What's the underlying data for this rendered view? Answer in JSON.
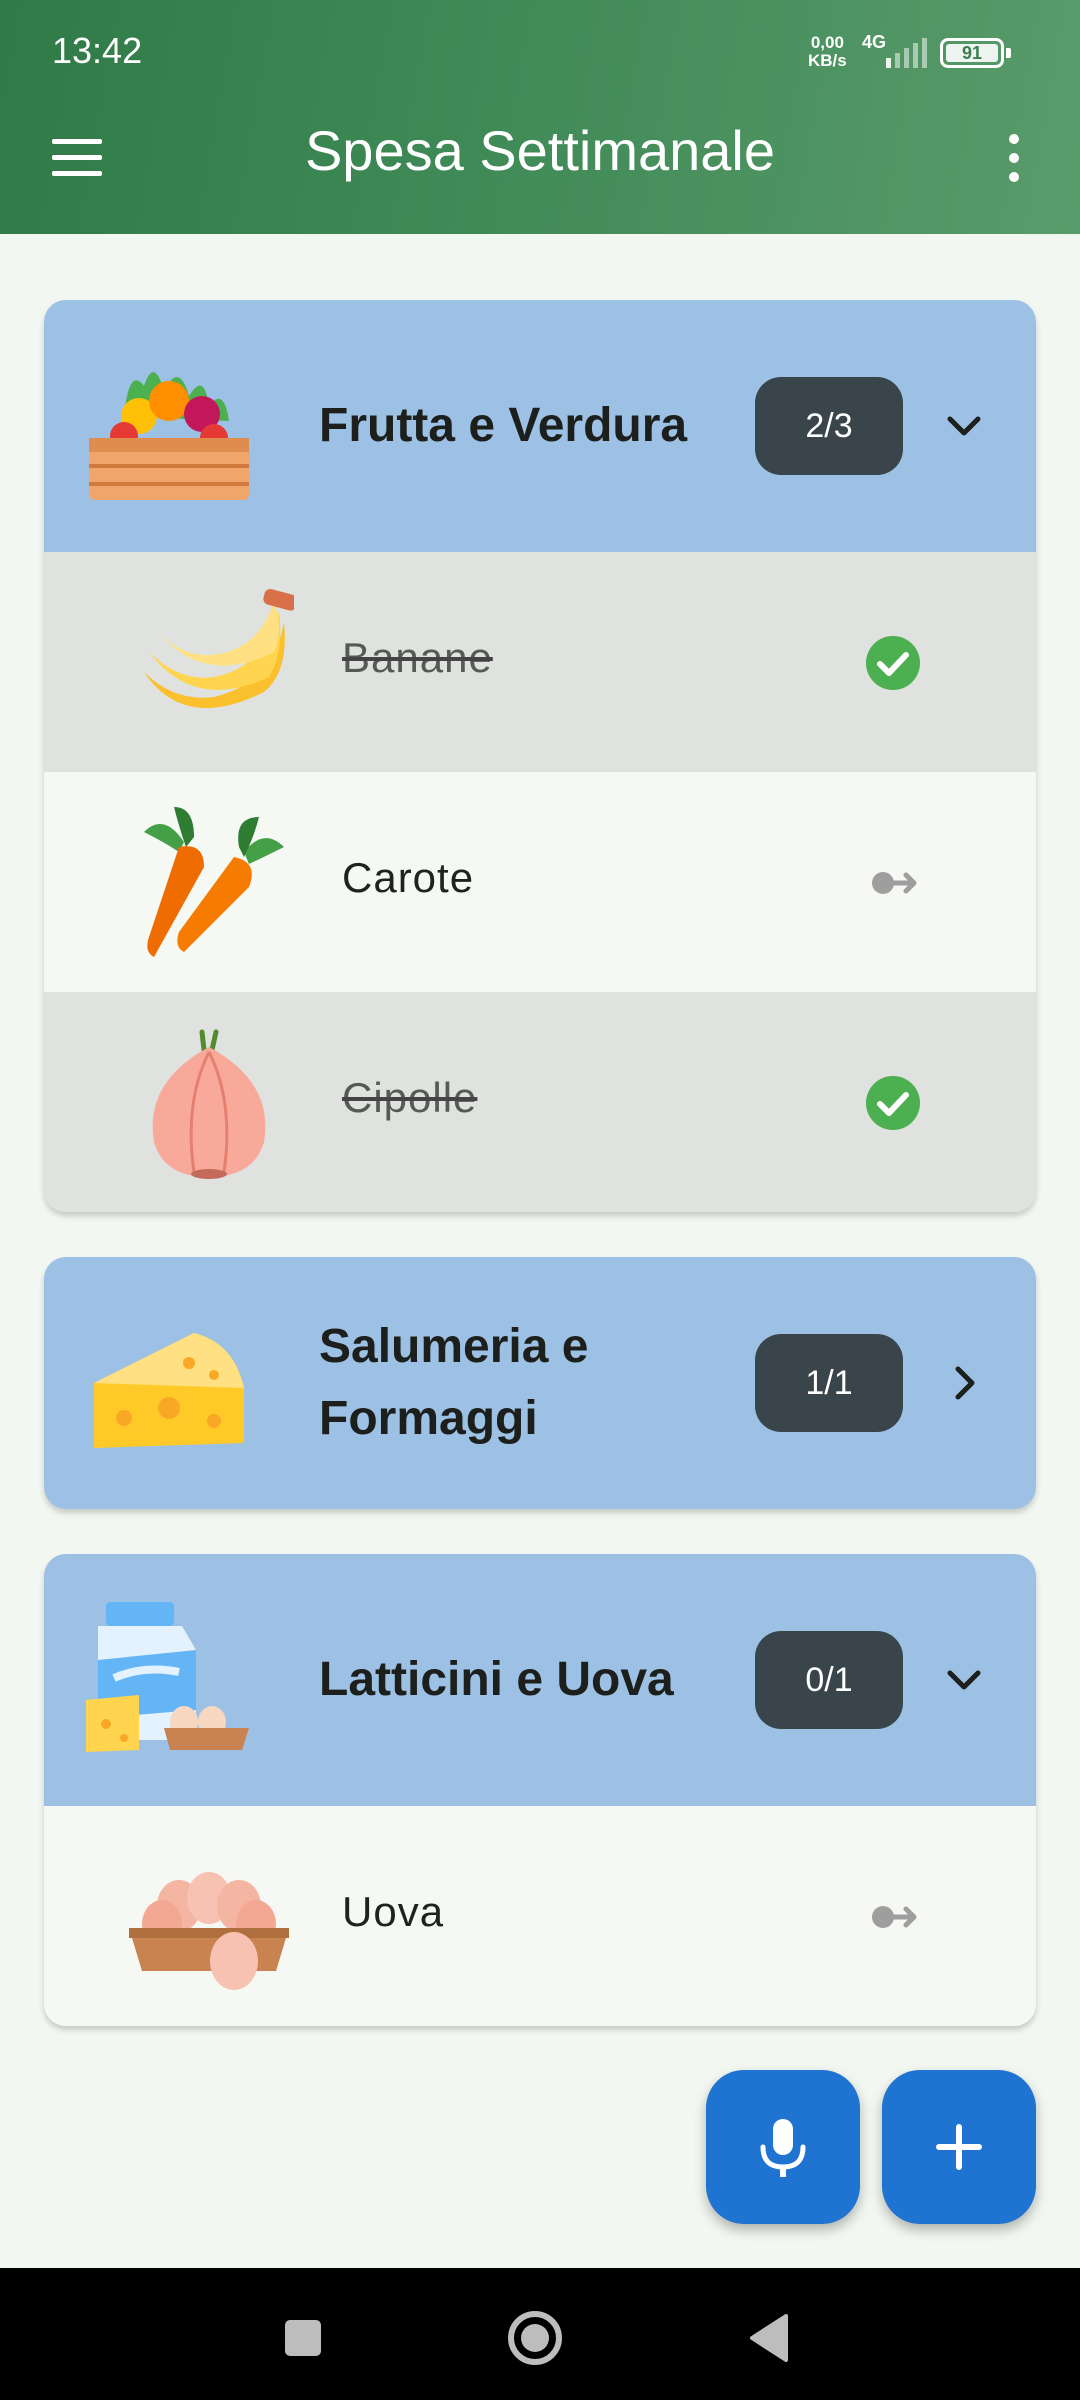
{
  "status_bar": {
    "time": "13:42",
    "net_speed_value": "0,00",
    "net_speed_unit": "KB/s",
    "network_type": "4G",
    "battery": "91"
  },
  "app_bar": {
    "title": "Spesa Settimanale",
    "menu_icon": "hamburger-menu-icon",
    "more_icon": "more-vert-icon"
  },
  "categories": [
    {
      "name": "Frutta e Verdura",
      "count": "2/3",
      "expanded": true,
      "icon": "vegetable-crate-icon",
      "items": [
        {
          "name": "Banane",
          "checked": true,
          "icon": "banana-icon"
        },
        {
          "name": "Carote",
          "checked": false,
          "icon": "carrot-icon"
        },
        {
          "name": "Cipolle",
          "checked": true,
          "icon": "onion-icon"
        }
      ]
    },
    {
      "name_line1": "Salumeria e",
      "name_line2": "Formaggi",
      "count": "1/1",
      "expanded": false,
      "icon": "cheese-icon"
    },
    {
      "name": "Latticini e Uova",
      "count": "0/1",
      "expanded": true,
      "icon": "milk-and-eggs-icon",
      "items": [
        {
          "name": "Uova",
          "checked": false,
          "icon": "egg-carton-icon"
        }
      ]
    }
  ],
  "colors": {
    "app_bar": "#3a8350",
    "category_header": "#9dc1e4",
    "count_badge": "#3a454b",
    "checked_row": "#dfe2df",
    "check_green": "#4caf50",
    "fab": "#1f74d2"
  },
  "fabs": {
    "voice_icon": "microphone-icon",
    "add_icon": "plus-icon"
  }
}
